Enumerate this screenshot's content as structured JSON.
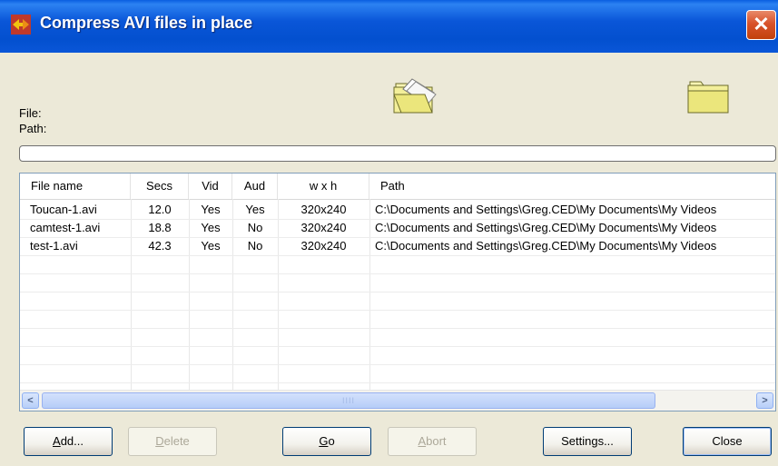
{
  "window": {
    "title": "Compress AVI files in place",
    "close_label": "✕"
  },
  "labels": {
    "file": "File:",
    "path": "Path:"
  },
  "list": {
    "columns": [
      "File name",
      "Secs",
      "Vid",
      "Aud",
      "w x h",
      "Path"
    ],
    "rows": [
      {
        "name": "Toucan-1.avi",
        "secs": "12.0",
        "vid": "Yes",
        "aud": "Yes",
        "wh": "320x240",
        "path": "C:\\Documents and Settings\\Greg.CED\\My Documents\\My Videos"
      },
      {
        "name": "camtest-1.avi",
        "secs": "18.8",
        "vid": "Yes",
        "aud": "No",
        "wh": "320x240",
        "path": "C:\\Documents and Settings\\Greg.CED\\My Documents\\My Videos"
      },
      {
        "name": "test-1.avi",
        "secs": "42.3",
        "vid": "Yes",
        "aud": "No",
        "wh": "320x240",
        "path": "C:\\Documents and Settings\\Greg.CED\\My Documents\\My Videos"
      }
    ],
    "scroll_left": "<",
    "scroll_right": ">",
    "thumb_grip": "IIII"
  },
  "buttons": {
    "add": {
      "accel": "A",
      "rest": "dd..."
    },
    "delete": {
      "accel": "D",
      "rest": "elete"
    },
    "go": {
      "accel": "G",
      "rest": "o"
    },
    "abort": {
      "accel": "A",
      "rest": "bort"
    },
    "settings": "Settings...",
    "close": "Close"
  },
  "icons": {
    "app": "app-window-icon",
    "open_file": "open-folder-file-icon",
    "open_folder": "folder-icon"
  },
  "colors": {
    "titlebar": "#0a56d8",
    "window_bg": "#ece9d8",
    "close_button": "#d8532b",
    "folder_yellow": "#f3ef9a"
  }
}
